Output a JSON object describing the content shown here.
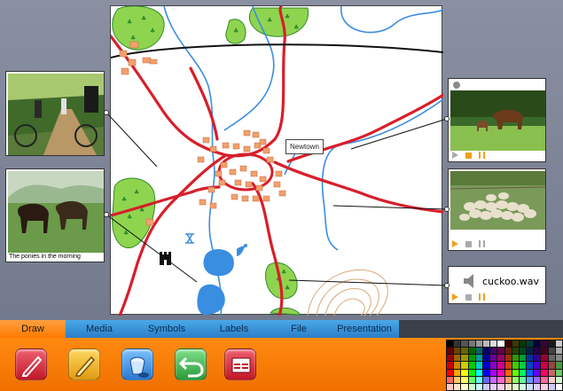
{
  "map": {
    "town_label": "Newtown"
  },
  "photos": [
    {
      "id": "cyclists",
      "caption": ""
    },
    {
      "id": "ponies",
      "caption": "The ponies in the morning"
    }
  ],
  "media": [
    {
      "id": "horse-video",
      "type": "video"
    },
    {
      "id": "sheep-video",
      "type": "video"
    },
    {
      "id": "cuckoo-sound",
      "type": "sound",
      "label": "cuckoo.wav"
    }
  ],
  "tabs": [
    {
      "label": "Draw",
      "active": true
    },
    {
      "label": "Media",
      "active": false
    },
    {
      "label": "Symbols",
      "active": false
    },
    {
      "label": "Labels",
      "active": false
    },
    {
      "label": "File",
      "active": false
    },
    {
      "label": "Presentation",
      "active": false
    }
  ],
  "tools": [
    {
      "icon": "pencil-red-icon",
      "color": "#d8283a"
    },
    {
      "icon": "pencil-yellow-icon",
      "color": "#f5b820"
    },
    {
      "icon": "paint-bucket-icon",
      "color": "#3a8ee0"
    },
    {
      "icon": "undo-icon",
      "color": "#38b048"
    },
    {
      "icon": "delete-layer-icon",
      "color": "#d82838"
    }
  ],
  "palette": [
    "#000000",
    "#333333",
    "#555555",
    "#777777",
    "#999999",
    "#bbbbbb",
    "#dddddd",
    "#ffffff",
    "#3a0000",
    "#3a3a00",
    "#003a00",
    "#003a3a",
    "#00003a",
    "#3a003a",
    "#1a1a1a",
    "#cccccc",
    "#660000",
    "#664400",
    "#666600",
    "#006600",
    "#006666",
    "#000066",
    "#440066",
    "#660044",
    "#662200",
    "#224400",
    "#004422",
    "#002244",
    "#220044",
    "#440022",
    "#444444",
    "#aaaaaa",
    "#990000",
    "#996600",
    "#999900",
    "#009900",
    "#009999",
    "#000099",
    "#660099",
    "#990066",
    "#993300",
    "#339900",
    "#009933",
    "#003399",
    "#330099",
    "#990033",
    "#666666",
    "#888888",
    "#cc0000",
    "#cc8800",
    "#cccc00",
    "#00cc00",
    "#00cccc",
    "#0000cc",
    "#8800cc",
    "#cc0088",
    "#cc4400",
    "#44cc00",
    "#00cc44",
    "#0044cc",
    "#4400cc",
    "#cc0044",
    "#994444",
    "#449944",
    "#ff0000",
    "#ffaa00",
    "#ffff00",
    "#00ff00",
    "#00ffff",
    "#0000ff",
    "#aa00ff",
    "#ff00aa",
    "#ff6600",
    "#66ff00",
    "#00ff66",
    "#0066ff",
    "#6600ff",
    "#ff0066",
    "#cc6666",
    "#66cc66",
    "#ff6666",
    "#ffcc66",
    "#ffff66",
    "#66ff66",
    "#66ffff",
    "#6666ff",
    "#cc66ff",
    "#ff66cc",
    "#ff9966",
    "#99ff66",
    "#66ff99",
    "#6699ff",
    "#9966ff",
    "#ff6699",
    "#ffcccc",
    "#ccffcc",
    "#ffcccc",
    "#ffe6cc",
    "#ffffcc",
    "#ccffcc",
    "#ccffff",
    "#ccccff",
    "#e6ccff",
    "#ffcce6",
    "#ffe0cc",
    "#e0ffcc",
    "#ccffe0",
    "#cce0ff",
    "#e0ccff",
    "#ffcce0",
    "#ccccff",
    "#ffffff"
  ]
}
